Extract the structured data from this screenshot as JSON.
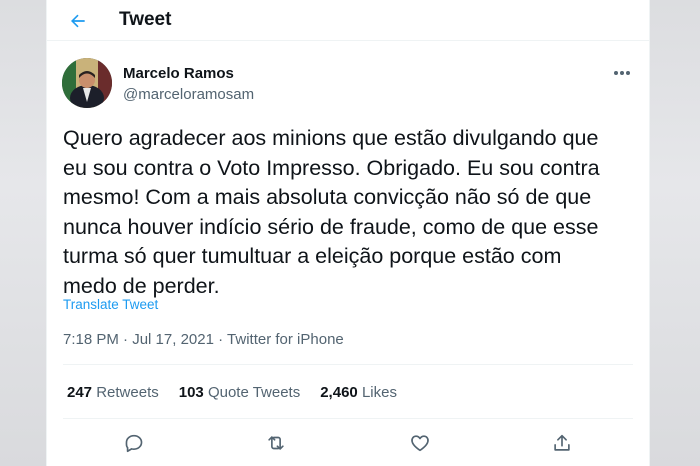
{
  "header": {
    "title": "Tweet"
  },
  "author": {
    "name": "Marcelo Ramos",
    "handle": "@marceloramosam"
  },
  "tweet": {
    "text": "Quero agradecer aos minions que estão divulgando que\neu sou contra o Voto Impresso. Obrigado. Eu sou contra\nmesmo! Com a mais absoluta convicção não só de que\nnunca houver indício sério de fraude, como de que esse\nturma só quer tumultuar a eleição porque estão com\nmedo de perder.",
    "translate_label": "Translate Tweet",
    "time": "7:18 PM",
    "date": "Jul 17, 2021",
    "separator": "·",
    "source": "Twitter for iPhone"
  },
  "stats": {
    "retweets_count": "247",
    "retweets_label": "Retweets",
    "quotes_count": "103",
    "quotes_label": "Quote Tweets",
    "likes_count": "2,460",
    "likes_label": "Likes"
  },
  "colors": {
    "accent": "#1d9bf0",
    "text_primary": "#0f1419",
    "text_secondary": "#536471",
    "divider": "#eff3f4"
  },
  "icons": {
    "back": "arrow-left-icon",
    "more": "more-horizontal-icon",
    "reply": "reply-icon",
    "retweet": "retweet-icon",
    "like": "heart-icon",
    "share": "share-icon"
  }
}
